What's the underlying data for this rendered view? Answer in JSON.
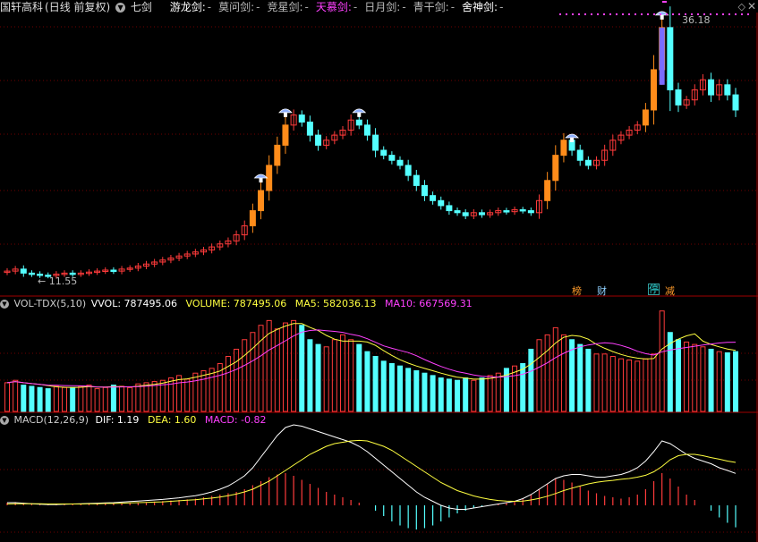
{
  "header": {
    "stock_name": "国轩高科",
    "period": "(日线 前复权)",
    "indicator": "七剑",
    "swords": [
      {
        "label": "游龙剑:",
        "color": "#ffffff",
        "value": "-"
      },
      {
        "label": "莫问剑:",
        "color": "#bbbbbb",
        "value": "-"
      },
      {
        "label": "竞星剑:",
        "color": "#bbbbbb",
        "value": "-"
      },
      {
        "label": "天慕剑:",
        "color": "#ff40ff",
        "value": "-"
      },
      {
        "label": "日月剑:",
        "color": "#bbbbbb",
        "value": "-"
      },
      {
        "label": "青干剑:",
        "color": "#bbbbbb",
        "value": "-"
      },
      {
        "label": "舍神剑:",
        "color": "#ffffff",
        "value": "-"
      }
    ]
  },
  "price_chart": {
    "high_label": "36.18",
    "low_label": "← 11.55",
    "tags": [
      {
        "text": "榜",
        "color": "#ff9a2a"
      },
      {
        "text": "财",
        "color": "#8fd0ff"
      },
      {
        "text": "停",
        "color": "#30e0e0"
      },
      {
        "text": "减",
        "color": "#ff9a2a"
      }
    ]
  },
  "volume_panel": {
    "title": "VOL-TDX(5,10)",
    "vvol": "VVOL: 787495.06",
    "volume": "VOLUME: 787495.06",
    "ma5": "MA5: 582036.13",
    "ma10": "MA10: 667569.31",
    "colors": {
      "vvol": "#ffffff",
      "volume": "#ffff40",
      "ma5": "#ffff40",
      "ma10": "#ff40ff"
    }
  },
  "macd_panel": {
    "title": "MACD(12,26,9)",
    "dif": "DIF: 1.19",
    "dea": "DEA: 1.60",
    "macd": "MACD: -0.82",
    "colors": {
      "dif": "#ffffff",
      "dea": "#ffff40",
      "macd": "#ff40ff"
    }
  },
  "chart_data": {
    "type": "candlestick",
    "title": "国轩高科 (日线 前复权)",
    "price_high": 36.18,
    "price_low": 11.55,
    "price_levels": [
      12.0,
      12.2,
      11.8,
      11.7,
      11.6,
      11.55,
      11.7,
      11.8,
      11.7,
      11.8,
      11.9,
      12.0,
      12.1,
      12.0,
      12.2,
      12.3,
      12.5,
      12.7,
      12.9,
      13.1,
      13.3,
      13.5,
      13.7,
      13.9,
      14.1,
      14.4,
      14.7,
      15.0,
      15.6,
      16.5,
      18.0,
      20.0,
      22.5,
      24.5,
      26.5,
      27.5,
      26.8,
      25.5,
      24.5,
      25.0,
      25.5,
      26.0,
      27.0,
      26.5,
      25.5,
      24.0,
      23.5,
      23.0,
      22.5,
      21.5,
      20.5,
      19.5,
      19.0,
      18.5,
      18.0,
      17.8,
      17.5,
      17.8,
      17.6,
      17.8,
      18.0,
      17.9,
      18.1,
      18.0,
      17.8,
      19.0,
      21.0,
      23.5,
      25.0,
      24.0,
      23.0,
      22.5,
      23.0,
      24.0,
      25.0,
      25.5,
      26.0,
      26.5,
      28.0,
      32.0,
      36.18,
      30.0,
      28.5,
      29.0,
      30.0,
      31.0,
      29.5,
      30.5,
      29.5,
      28.0
    ],
    "volume": [
      120,
      130,
      110,
      105,
      100,
      95,
      105,
      100,
      100,
      105,
      110,
      95,
      100,
      110,
      105,
      100,
      115,
      120,
      125,
      130,
      140,
      150,
      135,
      160,
      170,
      180,
      200,
      230,
      260,
      300,
      330,
      360,
      380,
      345,
      370,
      380,
      360,
      300,
      280,
      270,
      300,
      320,
      300,
      280,
      250,
      230,
      210,
      200,
      190,
      180,
      170,
      160,
      150,
      140,
      135,
      130,
      140,
      130,
      140,
      150,
      160,
      180,
      190,
      200,
      260,
      300,
      320,
      350,
      320,
      300,
      280,
      260,
      240,
      240,
      230,
      220,
      215,
      210,
      220,
      240,
      420,
      330,
      300,
      290,
      280,
      270,
      260,
      250,
      245,
      250
    ],
    "macd_hist": [
      0.1,
      0.12,
      0.1,
      0.08,
      0.05,
      0.03,
      0.02,
      0.03,
      0.04,
      0.05,
      0.06,
      0.06,
      0.07,
      0.08,
      0.08,
      0.09,
      0.1,
      0.12,
      0.14,
      0.16,
      0.18,
      0.2,
      0.22,
      0.25,
      0.3,
      0.35,
      0.4,
      0.45,
      0.5,
      0.6,
      0.75,
      0.9,
      1.05,
      1.15,
      1.2,
      1.1,
      0.95,
      0.8,
      0.65,
      0.5,
      0.4,
      0.3,
      0.2,
      0.1,
      0.0,
      -0.2,
      -0.4,
      -0.6,
      -0.75,
      -0.85,
      -0.9,
      -0.85,
      -0.75,
      -0.6,
      -0.45,
      -0.3,
      -0.2,
      -0.1,
      -0.05,
      0.0,
      0.05,
      0.1,
      0.15,
      0.25,
      0.4,
      0.6,
      0.8,
      1.0,
      0.95,
      0.85,
      0.7,
      0.55,
      0.45,
      0.35,
      0.3,
      0.25,
      0.3,
      0.4,
      0.6,
      0.9,
      1.2,
      1.0,
      0.7,
      0.4,
      0.2,
      0.0,
      -0.2,
      -0.45,
      -0.65,
      -0.82
    ],
    "dif": [
      0.1,
      0.1,
      0.08,
      0.06,
      0.04,
      0.03,
      0.03,
      0.04,
      0.05,
      0.06,
      0.07,
      0.08,
      0.09,
      0.1,
      0.12,
      0.14,
      0.16,
      0.18,
      0.2,
      0.22,
      0.25,
      0.28,
      0.32,
      0.36,
      0.42,
      0.5,
      0.6,
      0.72,
      0.9,
      1.1,
      1.4,
      1.8,
      2.2,
      2.6,
      2.9,
      3.0,
      2.95,
      2.85,
      2.75,
      2.65,
      2.55,
      2.45,
      2.35,
      2.2,
      2.0,
      1.75,
      1.5,
      1.25,
      1.0,
      0.75,
      0.5,
      0.3,
      0.15,
      0.0,
      -0.1,
      -0.15,
      -0.15,
      -0.1,
      -0.05,
      0.0,
      0.05,
      0.1,
      0.15,
      0.25,
      0.4,
      0.6,
      0.8,
      1.0,
      1.1,
      1.15,
      1.15,
      1.1,
      1.05,
      1.05,
      1.1,
      1.15,
      1.25,
      1.4,
      1.65,
      2.0,
      2.4,
      2.3,
      2.1,
      1.9,
      1.75,
      1.65,
      1.55,
      1.4,
      1.3,
      1.19
    ],
    "dea": [
      0.05,
      0.06,
      0.06,
      0.06,
      0.06,
      0.05,
      0.05,
      0.05,
      0.05,
      0.05,
      0.06,
      0.06,
      0.07,
      0.07,
      0.08,
      0.09,
      0.1,
      0.11,
      0.12,
      0.13,
      0.15,
      0.17,
      0.19,
      0.21,
      0.24,
      0.27,
      0.31,
      0.36,
      0.42,
      0.5,
      0.6,
      0.75,
      0.9,
      1.1,
      1.3,
      1.5,
      1.7,
      1.9,
      2.05,
      2.2,
      2.3,
      2.35,
      2.4,
      2.42,
      2.4,
      2.3,
      2.2,
      2.05,
      1.85,
      1.65,
      1.45,
      1.25,
      1.05,
      0.85,
      0.7,
      0.55,
      0.45,
      0.35,
      0.28,
      0.22,
      0.18,
      0.16,
      0.15,
      0.16,
      0.2,
      0.26,
      0.34,
      0.44,
      0.55,
      0.64,
      0.72,
      0.8,
      0.86,
      0.9,
      0.93,
      0.97,
      1.0,
      1.05,
      1.12,
      1.25,
      1.45,
      1.7,
      1.85,
      1.9,
      1.9,
      1.85,
      1.78,
      1.72,
      1.65,
      1.6
    ]
  }
}
